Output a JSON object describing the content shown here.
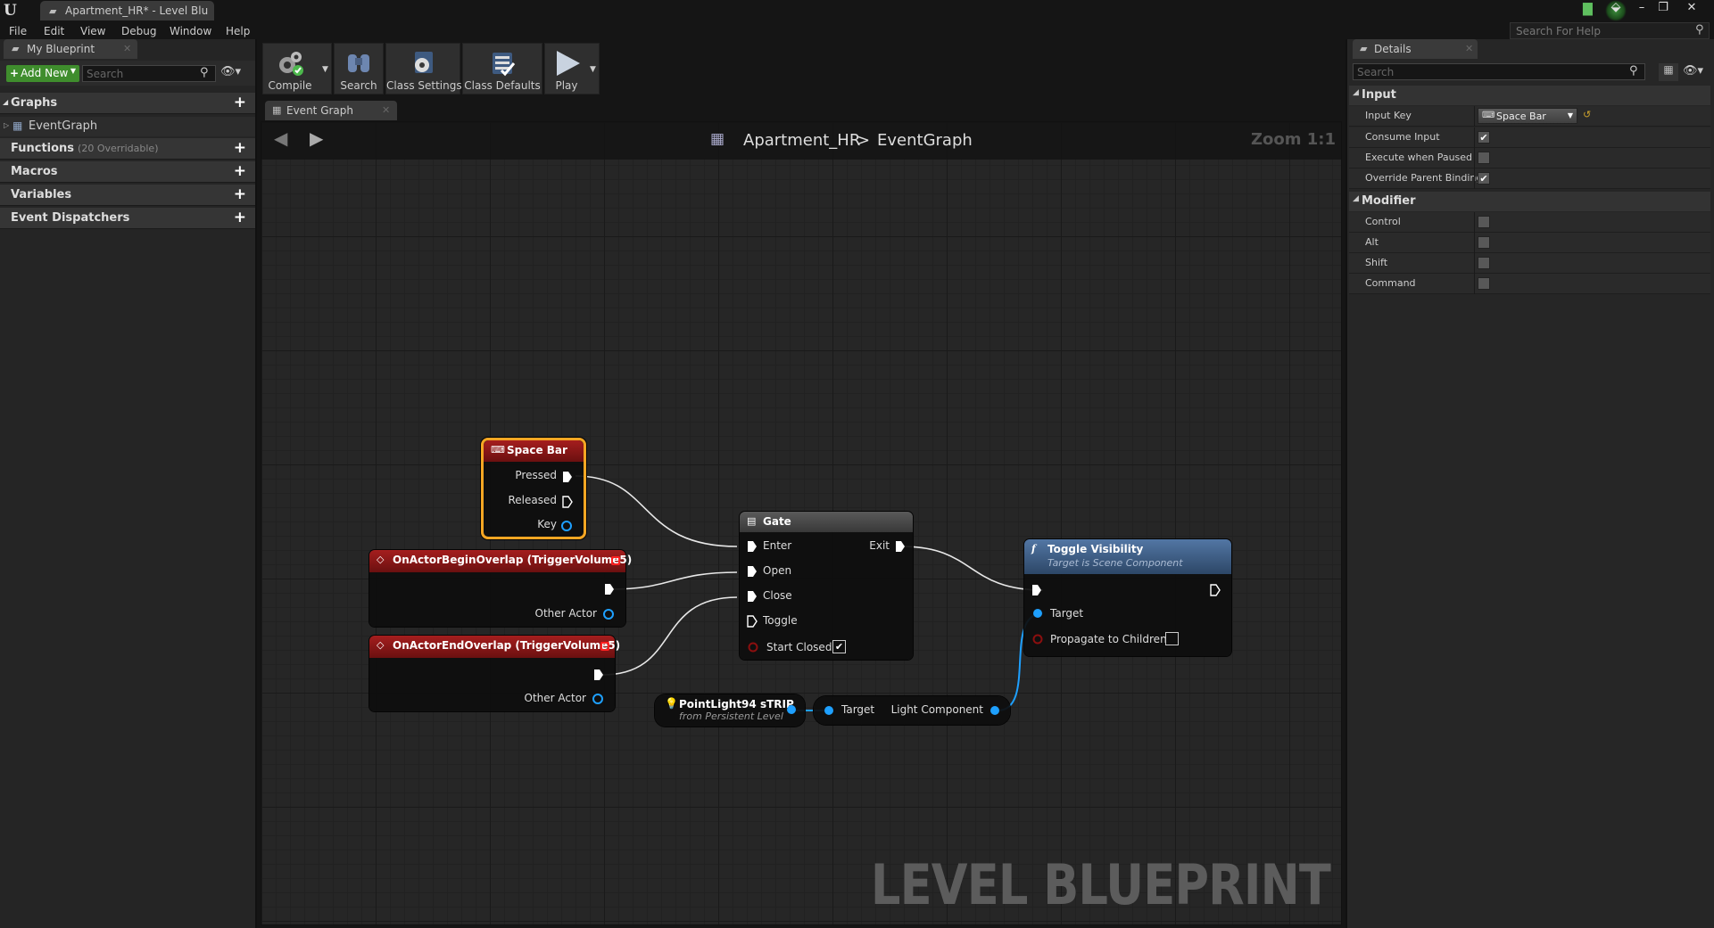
{
  "window": {
    "tab_title": "Apartment_HR* - Level Blu",
    "help_search_placeholder": "Search For Help",
    "controls": {
      "minimize": "–",
      "restore": "❐",
      "close": "✕"
    }
  },
  "menu": [
    "File",
    "Edit",
    "View",
    "Debug",
    "Window",
    "Help"
  ],
  "my_blueprint": {
    "tab_label": "My Blueprint",
    "add_new_label": "Add New",
    "search_placeholder": "Search",
    "sections": {
      "graphs": "Graphs",
      "graph_items": [
        "EventGraph"
      ],
      "functions": "Functions",
      "functions_sub": "(20 Overridable)",
      "macros": "Macros",
      "variables": "Variables",
      "dispatchers": "Event Dispatchers"
    }
  },
  "toolbar": {
    "compile": "Compile",
    "search": "Search",
    "class_settings": "Class Settings",
    "class_defaults": "Class Defaults",
    "play": "Play"
  },
  "graph_tab": {
    "label": "Event Graph"
  },
  "graph_header": {
    "blueprint": "Apartment_HR",
    "separator": ">",
    "graph": "EventGraph",
    "zoom": "Zoom 1:1"
  },
  "watermark": "LEVEL BLUEPRINT",
  "nodes": {
    "space_bar": {
      "title": "Space Bar",
      "pins": [
        "Pressed",
        "Released",
        "Key"
      ]
    },
    "begin_overlap": {
      "title": "OnActorBeginOverlap (TriggerVolume5)",
      "pins": [
        "Other Actor"
      ]
    },
    "end_overlap": {
      "title": "OnActorEndOverlap (TriggerVolume5)",
      "pins": [
        "Other Actor"
      ]
    },
    "gate": {
      "title": "Gate",
      "inputs": [
        "Enter",
        "Open",
        "Close",
        "Toggle",
        "Start Closed"
      ],
      "outputs": [
        "Exit"
      ],
      "start_closed": true
    },
    "toggle_visibility": {
      "title": "Toggle Visibility",
      "subtitle": "Target is Scene Component",
      "pins": [
        "Target",
        "Propagate to Children"
      ],
      "propagate": false
    },
    "point_light": {
      "title": "PointLight94 sTRIP",
      "subtitle": "from Persistent Level"
    },
    "light_component": {
      "target": "Target",
      "output": "Light Component"
    }
  },
  "details": {
    "tab_label": "Details",
    "search_placeholder": "Search",
    "input": {
      "header": "Input",
      "rows": [
        {
          "label": "Input Key",
          "value": "Space Bar"
        },
        {
          "label": "Consume Input",
          "checked": true
        },
        {
          "label": "Execute when Paused",
          "checked": false
        },
        {
          "label": "Override Parent Binding",
          "checked": true
        }
      ]
    },
    "modifier": {
      "header": "Modifier",
      "rows": [
        {
          "label": "Control",
          "checked": false
        },
        {
          "label": "Alt",
          "checked": false
        },
        {
          "label": "Shift",
          "checked": false
        },
        {
          "label": "Command",
          "checked": false
        }
      ]
    }
  },
  "colors": {
    "event_header": "#a51e1e",
    "function_header": "#5276a4",
    "macro_header": "#5a5a5a",
    "selection": "#f5a623",
    "object_pin": "#1ea0ff",
    "add_new": "#3f8d2d"
  }
}
